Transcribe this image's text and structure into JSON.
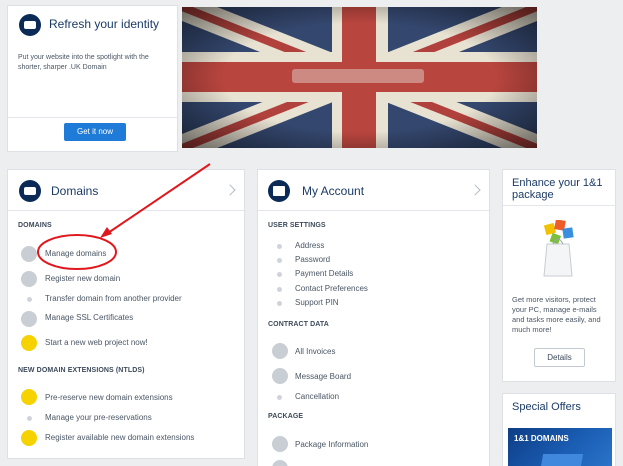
{
  "promo": {
    "title": "Refresh your identity",
    "body_line1": "Put your website into the spotlight with the",
    "body_line2": "shorter, sharper .UK Domain",
    "button": "Get it now"
  },
  "domains": {
    "title": "Domains",
    "section1": "DOMAINS",
    "items": [
      "Manage domains",
      "Register new domain",
      "Transfer domain from another provider",
      "Manage SSL Certificates",
      "Start a new web project now!"
    ],
    "section2": "NEW DOMAIN EXTENSIONS (NTLDS)",
    "items2": [
      "Pre-reserve new domain extensions",
      "Manage your pre-reservations",
      "Register available new domain extensions"
    ]
  },
  "account": {
    "title": "My Account",
    "section1": "USER SETTINGS",
    "items1": [
      "Address",
      "Password",
      "Payment Details",
      "Contact Preferences",
      "Support PIN"
    ],
    "section2": "CONTRACT DATA",
    "items2": [
      "All Invoices",
      "Message Board",
      "Cancellation"
    ],
    "section3": "PACKAGE",
    "items3": [
      "Package Information"
    ]
  },
  "enhance": {
    "title_line1": "Enhance your 1&1",
    "title_line2": "package",
    "body_line1": "Get more visitors, protect",
    "body_line2": "your PC, manage e-mails",
    "body_line3": "and tasks more easily, and",
    "body_line4": "much more!",
    "button": "Details"
  },
  "offers": {
    "title": "Special Offers",
    "banner": "1&1 DOMAINS"
  },
  "colors": {
    "primary_button": "#1e7bd7",
    "annotation": "#e0181e",
    "navy": "#0b2a55"
  }
}
